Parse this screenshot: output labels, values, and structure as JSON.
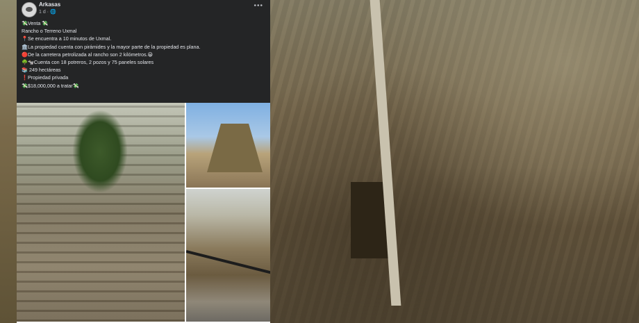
{
  "post": {
    "author": "Arkasas",
    "time": "1 d · 🌐",
    "more_icon": "more-options-icon",
    "lines": [
      "💸Venta 💸",
      "Rancho o Terreno Uxmal",
      "📍Se encuentra a 10 minutos de Uxmal.",
      "",
      "🏛️La propiedad cuenta con pirámides y la mayor parte de la propiedad es plana.",
      "",
      "🔴De la carretera petrolizada al rancho son 2 kilómetros.😀",
      "",
      "🌳🐄Cuenta con 18 potreros, 2 pozos y 75 paneles solares",
      "📚 249 hectáreas",
      "",
      "❗Propiedad privada",
      "💸$18,000,000 a tratar💸"
    ]
  },
  "colors": {
    "header_bg": "#242526",
    "header_text": "#e4e6eb",
    "secondary_text": "#b0b3b8"
  }
}
